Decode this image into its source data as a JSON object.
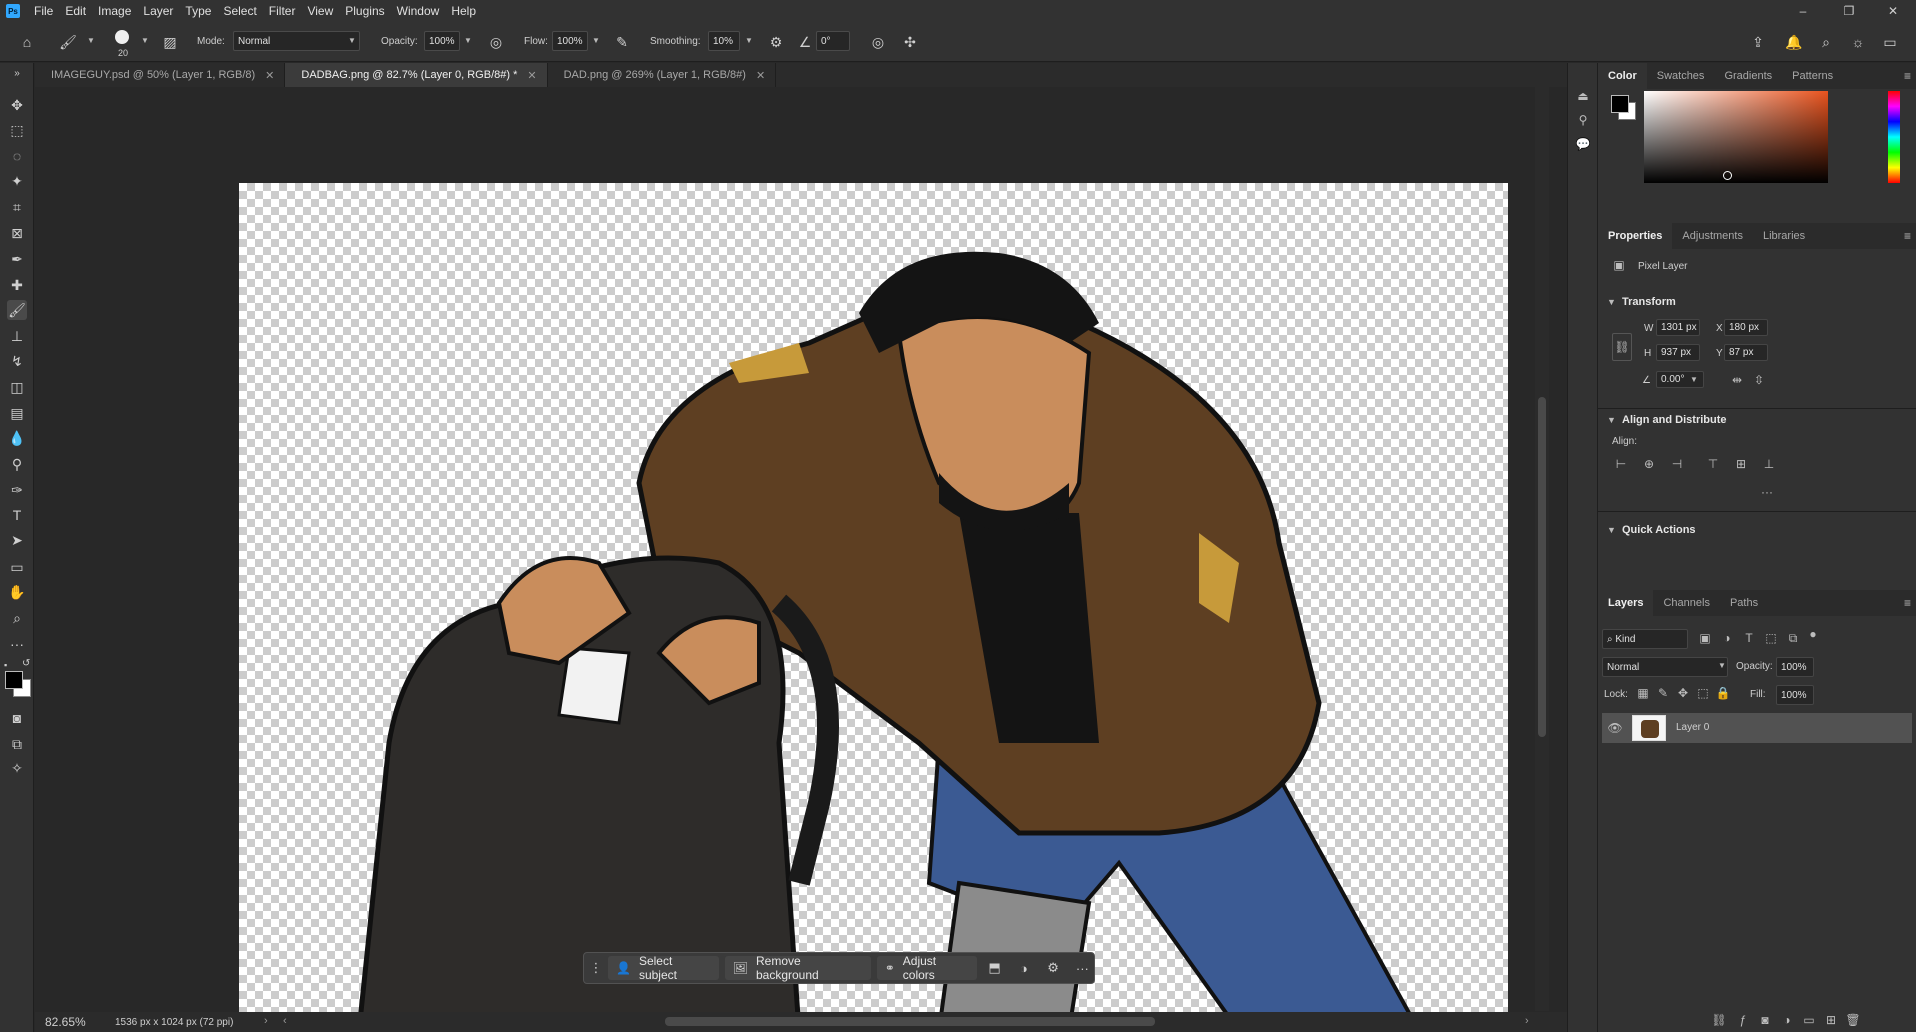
{
  "app": {
    "logo": "Ps"
  },
  "menu": [
    "File",
    "Edit",
    "Image",
    "Layer",
    "Type",
    "Select",
    "Filter",
    "View",
    "Plugins",
    "Window",
    "Help"
  ],
  "window_controls": {
    "minimize": "–",
    "restore": "❐",
    "close": "✕"
  },
  "options_bar": {
    "brush_size": "20",
    "mode_label": "Mode:",
    "mode_value": "Normal",
    "opacity_label": "Opacity:",
    "opacity_value": "100%",
    "flow_label": "Flow:",
    "flow_value": "100%",
    "smoothing_label": "Smoothing:",
    "smoothing_value": "10%",
    "angle_value": "0°"
  },
  "tabs": [
    {
      "label": "IMAGEGUY.psd @ 50% (Layer 1, RGB/8)",
      "active": false
    },
    {
      "label": "DADBAG.png @ 82.7% (Layer 0, RGB/8#) *",
      "active": true
    },
    {
      "label": "DAD.png @ 269% (Layer 1, RGB/8#)",
      "active": false
    }
  ],
  "contextual_taskbar": {
    "select_subject": "Select subject",
    "remove_background": "Remove background",
    "adjust_colors": "Adjust colors"
  },
  "status": {
    "zoom": "82.65%",
    "doc_info": "1536 px x 1024 px (72 ppi)"
  },
  "color_panel": {
    "tabs": [
      "Color",
      "Swatches",
      "Gradients",
      "Patterns"
    ],
    "foreground": "#000000",
    "background": "#ffffff",
    "hue_color": "#e8531e"
  },
  "properties_panel": {
    "tabs": [
      "Properties",
      "Adjustments",
      "Libraries"
    ],
    "layer_type": "Pixel Layer",
    "transform_title": "Transform",
    "w_label": "W",
    "w_value": "1301 px",
    "h_label": "H",
    "h_value": "937 px",
    "x_label": "X",
    "x_value": "180 px",
    "y_label": "Y",
    "y_value": "87 px",
    "angle_value": "0.00°",
    "align_title": "Align and Distribute",
    "align_label": "Align:",
    "quick_actions_title": "Quick Actions"
  },
  "layers_panel": {
    "tabs": [
      "Layers",
      "Channels",
      "Paths"
    ],
    "kind_label": "Kind",
    "blend_mode": "Normal",
    "opacity_label": "Opacity:",
    "opacity_value": "100%",
    "lock_label": "Lock:",
    "fill_label": "Fill:",
    "fill_value": "100%",
    "layers": [
      {
        "name": "Layer 0",
        "visible": true
      }
    ]
  }
}
